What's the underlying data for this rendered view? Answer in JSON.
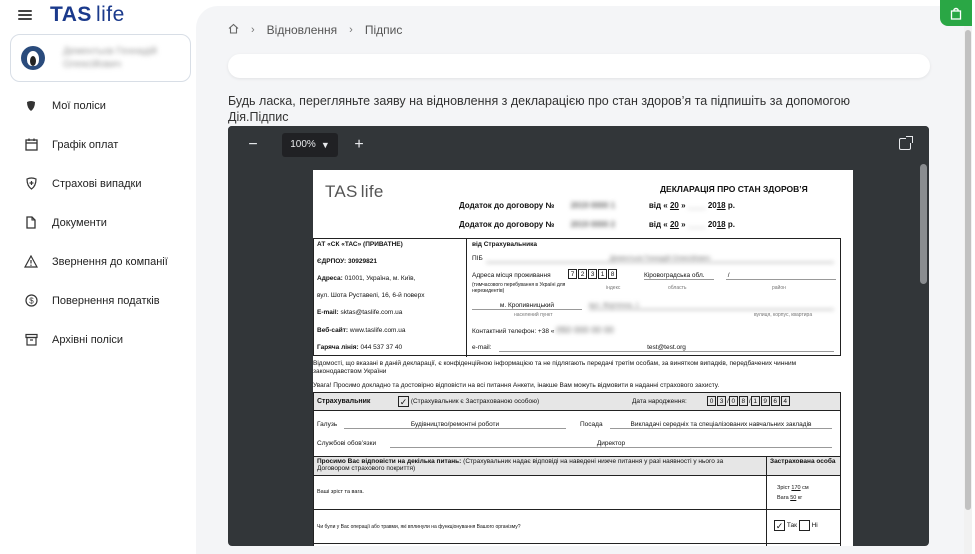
{
  "app": {
    "logo_main": "TAS",
    "logo_sub": "life"
  },
  "user": {
    "name_line1": "Дементьєв Геннадій",
    "name_line2": "Олексійович"
  },
  "nav": {
    "items": [
      {
        "label": "Мої поліси",
        "icon": "shield-filled-icon"
      },
      {
        "label": "Графік оплат",
        "icon": "calendar-icon"
      },
      {
        "label": "Страхові випадки",
        "icon": "shield-plus-icon"
      },
      {
        "label": "Документи",
        "icon": "document-icon"
      },
      {
        "label": "Звернення до компанії",
        "icon": "warning-icon"
      },
      {
        "label": "Повернення податків",
        "icon": "dollar-icon"
      },
      {
        "label": "Архівні поліси",
        "icon": "archive-icon"
      }
    ]
  },
  "breadcrumb": {
    "home": "home-icon",
    "item1": "Відновлення",
    "item2": "Підпис"
  },
  "instruction": "Будь ласка, перегляньте заяву на відновлення з декларацією про стан здоров’я та підпишіть за допомогою Дія.Підпис",
  "viewer": {
    "zoom": "100%",
    "minus": "−",
    "plus": "+"
  },
  "doc": {
    "logo_main": "TAS",
    "logo_sub": "life",
    "title": "ДЕКЛАРАЦІЯ ПРО СТАН ЗДОРОВ’Я",
    "addendum_label": "Додаток до договору №",
    "contract1": "2019 0000 1",
    "contract2": "2019 0000 2",
    "date_prefix": "від «",
    "day": "20",
    "month": "____",
    "year_prefix": "20",
    "year": "18",
    "year_suffix": "р.",
    "company": "АТ «СК «ТАС» (ПРИВАТНЕ)",
    "edrpou": "ЄДРПОУ: 30929821",
    "address_label": "Адреса:",
    "address1": "01001, Україна, м. Київ,",
    "address2": "вул. Шота Руставелі, 16, 6-й поверх",
    "email_label": "E-mail:",
    "email": "sktas@taslife.com.ua",
    "web_label": "Веб-сайт:",
    "web": "www.taslife.com.ua",
    "hotline_label": "Гаряча лінія:",
    "hotline": "044 537 37 40",
    "from_label": "від Страхувальника",
    "pib": "ПІБ",
    "pib_value": "Дементьєв Геннадій Олексійович",
    "residence": "Адреса місця проживання",
    "residence_note": "(тимчасового перебування в Україні для нерезидентів)",
    "postcode": [
      "7",
      "2",
      "3",
      "1",
      "8"
    ],
    "region": "Кіровоградська обл.",
    "index_label": "індекс",
    "region_label": "область",
    "district_label": "район",
    "city": "м. Кропивницький",
    "settlement_label": "населений пункт",
    "street_label": "вулиця, корпус, квартира",
    "phone_label": "Контактний телефон: +38 «",
    "email2_label": "e-mail:",
    "email2": "test@test.org",
    "notice": "Відомості, що вказані в даній декларації, є конфіденційною інформацією та не підлягають передачі третім особам, за винятком випадків, передбачених чинним законодавством України",
    "warning": "Увага! Просимо докладно та достовірно відповісти на всі питання Анкети, інакше Вам можуть відмовити в наданні страхового захисту.",
    "insurer_label": "Страхувальник",
    "insurer_note": "(Страхувальник є Застрахованою особою)",
    "birth_label": "Дата народження:",
    "birth_d": [
      "0",
      "3"
    ],
    "birth_m": [
      "0",
      "8"
    ],
    "birth_y": [
      "1",
      "9",
      "6",
      "4"
    ],
    "industry_label": "Галузь",
    "industry": "Будівництво/ремонтні роботи",
    "position_label": "Посада",
    "position": "Викладачі середніх та спеціалізованих навчальних закладів",
    "duties_label": "Службові обов’язки",
    "duties": "Директор",
    "questions_header": "Просимо Вас відповісти на декілька питань:",
    "questions_header_note": "(Страхувальник надає відповіді на наведені нижче питання у разі наявності у нього за Договором страхового покриття)",
    "insured_col": "Застрахована особа",
    "q1": "Ваші зріст та вага.",
    "height_label": "Зріст",
    "height": "170",
    "height_unit": "см",
    "weight_label": "Вага",
    "weight": "50",
    "weight_unit": "кг",
    "q2": "Чи були у Вас операції або травми, які вплинули на функціонування Вашого організму?",
    "yes": "Так",
    "no": "Ні"
  },
  "colors": {
    "accent": "#1b3a8c",
    "green": "#2aa745",
    "viewer_bg": "#323639"
  }
}
